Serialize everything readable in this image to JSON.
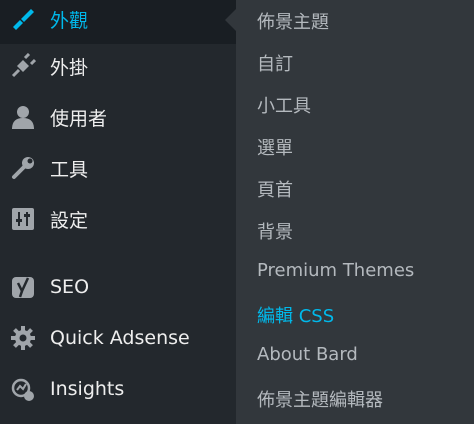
{
  "menu": {
    "items": [
      {
        "label": "外觀",
        "icon": "paintbrush-icon",
        "active": true
      },
      {
        "label": "外掛",
        "icon": "plugin-icon"
      },
      {
        "label": "使用者",
        "icon": "user-icon"
      },
      {
        "label": "工具",
        "icon": "wrench-icon"
      },
      {
        "label": "設定",
        "icon": "settings-sliders-icon"
      },
      {
        "label": "SEO",
        "icon": "yoast-icon"
      },
      {
        "label": "Quick Adsense",
        "icon": "gear-icon"
      },
      {
        "label": "Insights",
        "icon": "insights-icon"
      }
    ]
  },
  "submenu": {
    "items": [
      {
        "label": "佈景主題"
      },
      {
        "label": "自訂"
      },
      {
        "label": "小工具"
      },
      {
        "label": "選單"
      },
      {
        "label": "頁首"
      },
      {
        "label": "背景"
      },
      {
        "label": "Premium Themes"
      },
      {
        "label": "編輯 CSS",
        "current": true
      },
      {
        "label": "About Bard"
      },
      {
        "label": "佈景主題編輯器"
      }
    ]
  },
  "colors": {
    "menu_bg": "#23282d",
    "submenu_bg": "#32373c",
    "accent": "#00b9eb",
    "text": "#eeeeee"
  }
}
